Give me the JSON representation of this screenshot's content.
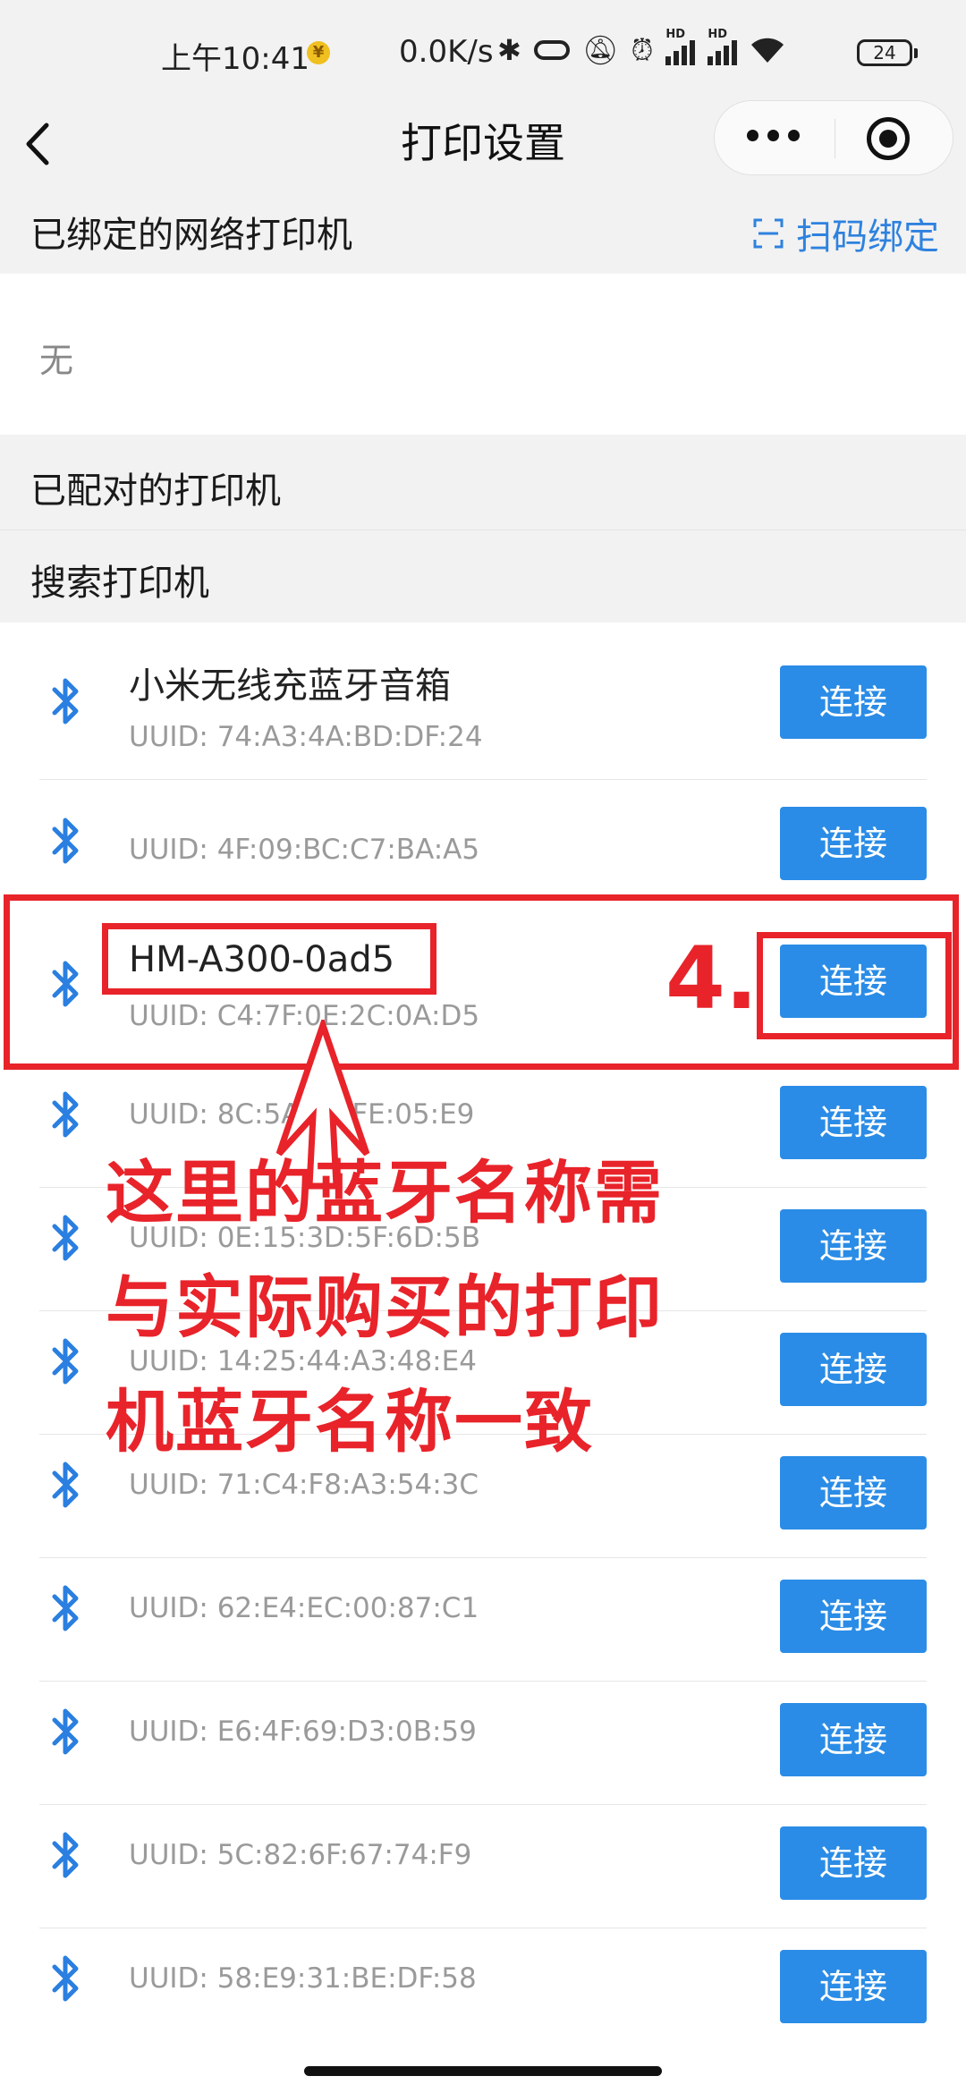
{
  "status": {
    "time": "上午10:41",
    "net": "0.0K/s",
    "battery": "24"
  },
  "nav": {
    "title": "打印设置"
  },
  "bound": {
    "title": "已绑定的网络打印机",
    "scan_label": "扫码绑定",
    "none": "无"
  },
  "paired": {
    "title": "已配对的打印机"
  },
  "search": {
    "title": "搜索打印机"
  },
  "devices": [
    {
      "name": "小米无线充蓝牙音箱",
      "uuid": "UUID: 74:A3:4A:BD:DF:24",
      "action": "连接"
    },
    {
      "name": "",
      "uuid": "UUID: 4F:09:BC:C7:BA:A5",
      "action": "连接"
    },
    {
      "name": "HM-A300-0ad5",
      "uuid": "UUID: C4:7F:0E:2C:0A:D5",
      "action": "连接"
    },
    {
      "name": "",
      "uuid": "UUID: 8C:5A:F8:FE:05:E9",
      "action": "连接"
    },
    {
      "name": "",
      "uuid": "UUID: 0E:15:3D:5F:6D:5B",
      "action": "连接"
    },
    {
      "name": "",
      "uuid": "UUID: 14:25:44:A3:48:E4",
      "action": "连接"
    },
    {
      "name": "",
      "uuid": "UUID: 71:C4:F8:A3:54:3C",
      "action": "连接"
    },
    {
      "name": "",
      "uuid": "UUID: 62:E4:EC:00:87:C1",
      "action": "连接"
    },
    {
      "name": "",
      "uuid": "UUID: E6:4F:69:D3:0B:59",
      "action": "连接"
    },
    {
      "name": "",
      "uuid": "UUID: 5C:82:6F:67:74:F9",
      "action": "连接"
    },
    {
      "name": "",
      "uuid": "UUID: 58:E9:31:BE:DF:58",
      "action": "连接"
    }
  ],
  "annotation": {
    "step": "4.",
    "note": "这里的蓝牙名称需与实际购买的打印机蓝牙名称一致"
  },
  "colors": {
    "accent": "#2a8ce6",
    "annotation": "#e8232a",
    "section_bg": "#f2f2f2"
  }
}
